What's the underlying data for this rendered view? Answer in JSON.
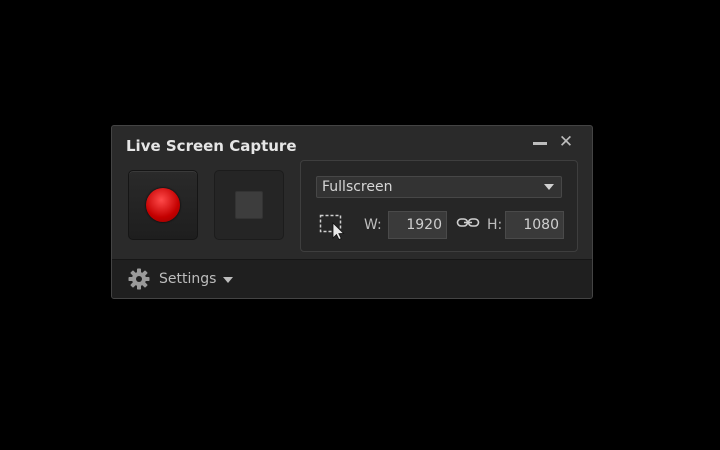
{
  "window": {
    "title": "Live Screen Capture",
    "close_glyph": "✕"
  },
  "controls": {
    "record_icon": "record-icon",
    "stop_icon": "stop-icon"
  },
  "region": {
    "mode_selected": "Fullscreen",
    "width_label": "W:",
    "width_value": "1920",
    "height_label": "H:",
    "height_value": "1080"
  },
  "footer": {
    "settings_label": "Settings"
  },
  "colors": {
    "background": "#000000",
    "panel": "#2a2a2a",
    "record": "#d00000",
    "text": "#bdbdbd"
  }
}
